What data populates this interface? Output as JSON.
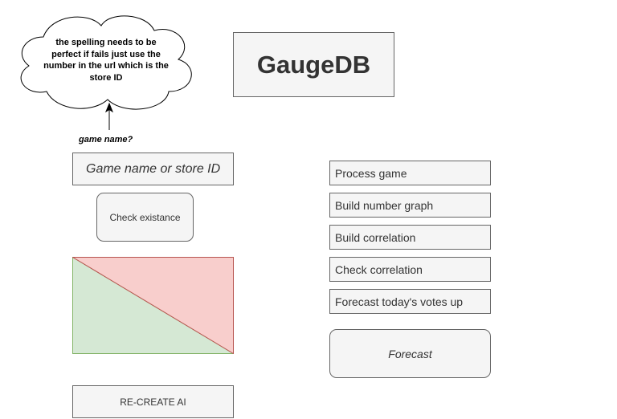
{
  "note": {
    "text": "the spelling needs to be perfect if fails just use the number in the url which is the store ID"
  },
  "input_section": {
    "question_label": "game name?",
    "input_placeholder": "Game name or store ID",
    "input_value": "",
    "check_button_label": "Check existance"
  },
  "header": {
    "title": "GaugeDB"
  },
  "status_indicator": {
    "success_color": "#d5e8d4",
    "success_border": "#82b366",
    "failure_color": "#f8cecc",
    "failure_border": "#b85450"
  },
  "actions": {
    "recreate_label": "RE-CREATE AI",
    "steps": [
      {
        "label": "Process game"
      },
      {
        "label": "Build number graph"
      },
      {
        "label": "Build correlation"
      },
      {
        "label": "Check correlation"
      },
      {
        "label": "Forecast today's votes up"
      }
    ],
    "forecast_label": "Forecast"
  }
}
